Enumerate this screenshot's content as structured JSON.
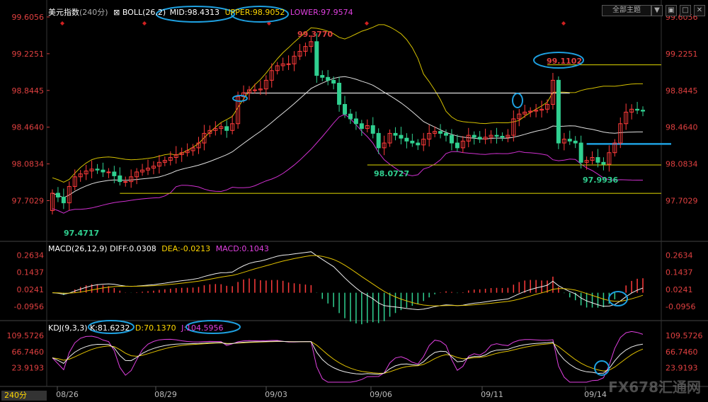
{
  "header": {
    "symbol": "美元指数",
    "period": "(240分)",
    "boll_label": "BOLL(26,2)",
    "mid_label": "MID:98.4313",
    "upper_label": "UPPER:98.9052",
    "lower_label": "LOWER:97.9574",
    "menu_label": "全部主题",
    "win_buttons": [
      "▼",
      "▣",
      "□",
      "✕"
    ]
  },
  "macd_header": {
    "name": "MACD(26,12,9)",
    "diff": "DIFF:0.0308",
    "dea": "DEA:-0.0213",
    "macd": "MACD:0.1043"
  },
  "kdj_header": {
    "name": "KDJ(9,3,3)",
    "k": "K:81.6232",
    "d": "D:70.1370",
    "j": "J:104.5956"
  },
  "period_tab": "240分",
  "watermark": "FX678汇通网",
  "axes": {
    "price_ticks": [
      "99.6056",
      "99.2251",
      "98.8445",
      "98.4640",
      "98.0834",
      "97.7029"
    ],
    "macd_ticks": [
      "0.2634",
      "0.1437",
      "0.0241",
      "-0.0956"
    ],
    "kdj_ticks": [
      "109.5726",
      "66.7460",
      "23.9193"
    ],
    "date_ticks": [
      "08/26",
      "08/29",
      "09/03",
      "09/06",
      "09/11",
      "09/14"
    ]
  },
  "annotations": {
    "high1": "99.3770",
    "high2": "99.1102",
    "low1": "97.4717",
    "low2": "98.0727",
    "low3": "97.9936"
  },
  "colors": {
    "up": "#ff3b3b",
    "down": "#30d090",
    "mid": "#e0e0e0",
    "upper": "#d4c000",
    "lower": "#d030d0",
    "hline": "#c8c000",
    "blue": "#1ea0e0"
  },
  "chart_data": {
    "type": "candlestick",
    "title": "美元指数 (240分)",
    "ylim": [
      97.45,
      99.62
    ],
    "levels": [
      99.1102,
      98.8175,
      98.0727,
      97.7785
    ],
    "close": [
      97.78,
      97.74,
      97.68,
      97.85,
      97.95,
      97.98,
      98.01,
      98.03,
      98.02,
      98.0,
      98.0,
      97.96,
      97.9,
      97.9,
      97.95,
      98.0,
      98.02,
      98.04,
      98.06,
      98.1,
      98.12,
      98.15,
      98.18,
      98.2,
      98.22,
      98.25,
      98.3,
      98.4,
      98.43,
      98.45,
      98.47,
      98.43,
      98.5,
      98.78,
      98.82,
      98.85,
      98.85,
      98.86,
      98.95,
      99.05,
      99.1,
      99.12,
      99.12,
      99.2,
      99.25,
      99.3,
      99.35,
      99.0,
      98.98,
      98.95,
      98.92,
      98.7,
      98.6,
      98.55,
      98.5,
      98.45,
      98.48,
      98.4,
      98.25,
      98.3,
      98.4,
      98.38,
      98.35,
      98.32,
      98.3,
      98.28,
      98.34,
      98.4,
      98.42,
      98.4,
      98.38,
      98.3,
      98.25,
      98.32,
      98.38,
      98.36,
      98.34,
      98.36,
      98.38,
      98.37,
      98.36,
      98.38,
      98.55,
      98.6,
      98.62,
      98.63,
      98.64,
      98.65,
      98.7,
      98.95,
      98.3,
      98.34,
      98.32,
      98.3,
      98.1,
      98.12,
      98.15,
      98.1,
      98.08,
      98.2,
      98.3,
      98.5,
      98.62,
      98.65,
      98.64,
      98.63
    ],
    "macd_ylim": [
      -0.17,
      0.29
    ],
    "kdj_ylim": [
      -15,
      125
    ],
    "x_dates": [
      "08/26",
      "08/29",
      "09/03",
      "09/06",
      "09/11",
      "09/14"
    ]
  }
}
